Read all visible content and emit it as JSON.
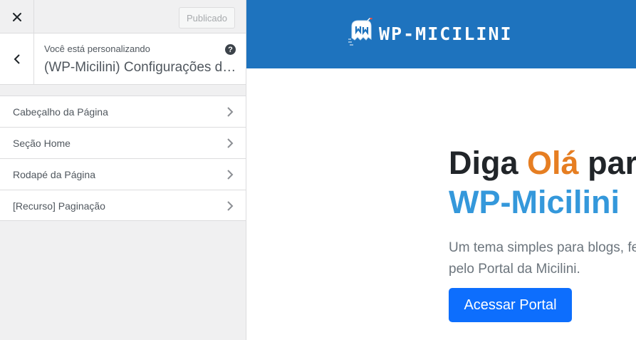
{
  "topbar": {
    "close_icon": "close-icon",
    "publish_label": "Publicado"
  },
  "info": {
    "customizing_label": "Você está personalizando",
    "section_title": "(WP-Micilini) Configurações do Tema",
    "help_icon": "help-icon",
    "help_glyph": "?"
  },
  "menu": {
    "items": [
      {
        "label": "Cabeçalho da Página"
      },
      {
        "label": "Seção Home"
      },
      {
        "label": "Rodapé da Página"
      },
      {
        "label": "[Recurso] Paginação"
      }
    ]
  },
  "preview": {
    "header_bg": "#1e73be",
    "logo_text": "WP-MICILINI",
    "hero": {
      "line1_start": "Diga ",
      "line1_accent": "Olá",
      "line1_end": " para o",
      "line2": "WP-Micilini",
      "desc_line1": "Um tema simples para blogs, feito",
      "desc_line2": "pelo Portal da Micilini.",
      "cta_label": "Acessar Portal"
    },
    "colors": {
      "accent_orange": "#e67e22",
      "accent_blue": "#3498db",
      "cta_blue": "#0d6efd"
    }
  }
}
